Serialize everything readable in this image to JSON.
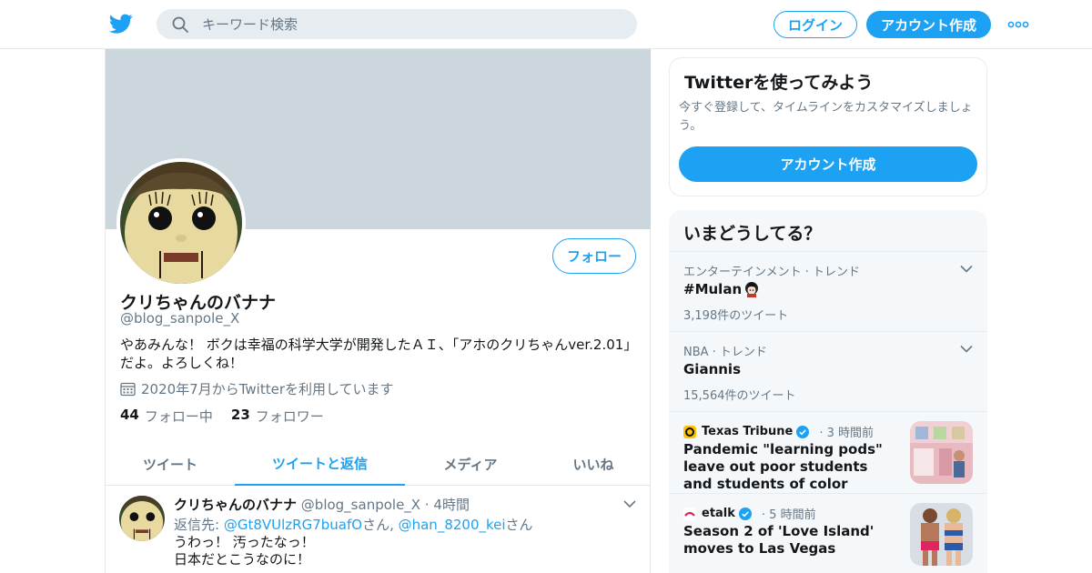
{
  "topbar": {
    "search_placeholder": "キーワード検索",
    "login_label": "ログイン",
    "signup_label": "アカウント作成"
  },
  "profile": {
    "name": "クリちゃんのバナナ",
    "handle": "@blog_sanpole_X",
    "follow_label": "フォロー",
    "bio_line1": "やあみんな！ ボクは幸福の科学大学が開発したＡＩ、「アホのクリちゃんver.2.01」",
    "bio_line2": "だよ。よろしくね！",
    "joined": "2020年7月からTwitterを利用しています",
    "following_count": "44",
    "following_label": "フォロー中",
    "followers_count": "23",
    "followers_label": "フォロワー"
  },
  "tabs": [
    {
      "label": "ツイート",
      "active": false
    },
    {
      "label": "ツイートと返信",
      "active": true
    },
    {
      "label": "メディア",
      "active": false
    },
    {
      "label": "いいね",
      "active": false
    }
  ],
  "tweet": {
    "name": "クリちゃんのバナナ",
    "handle": "@blog_sanpole_X",
    "dot": "·",
    "time": "4時間",
    "reply_prefix": "返信先: ",
    "reply_user1": "@Gt8VUlzRG7buafO",
    "reply_mid": "さん, ",
    "reply_user2": "@han_8200_kei",
    "reply_suffix": "さん",
    "text_line1": "うわっ！ 汚ったなっ！",
    "text_line2": "日本だとこうなのに！"
  },
  "signup_card": {
    "title": "Twitterを使ってみよう",
    "subtitle": "今すぐ登録して、タイムラインをカスタマイズしましょう。",
    "button": "アカウント作成"
  },
  "trends": {
    "header": "いまどうしてる？",
    "items": [
      {
        "category": "エンターテインメント · トレンド",
        "name": "#Mulan",
        "count": "3,198件のツイート"
      },
      {
        "category": "NBA · トレンド",
        "name": "Giannis",
        "count": "15,564件のツイート"
      }
    ],
    "news": [
      {
        "source": "Texas Tribune",
        "time": "· 3 時間前",
        "headline": "Pandemic \"learning pods\" leave out poor students and students of color"
      },
      {
        "source": "etalk",
        "time": "· 5 時間前",
        "headline": "Season 2 of 'Love Island' moves to Las Vegas"
      }
    ]
  },
  "colors": {
    "accent": "#1da1f2",
    "banner": "#ccd6dd",
    "muted": "#657786"
  }
}
